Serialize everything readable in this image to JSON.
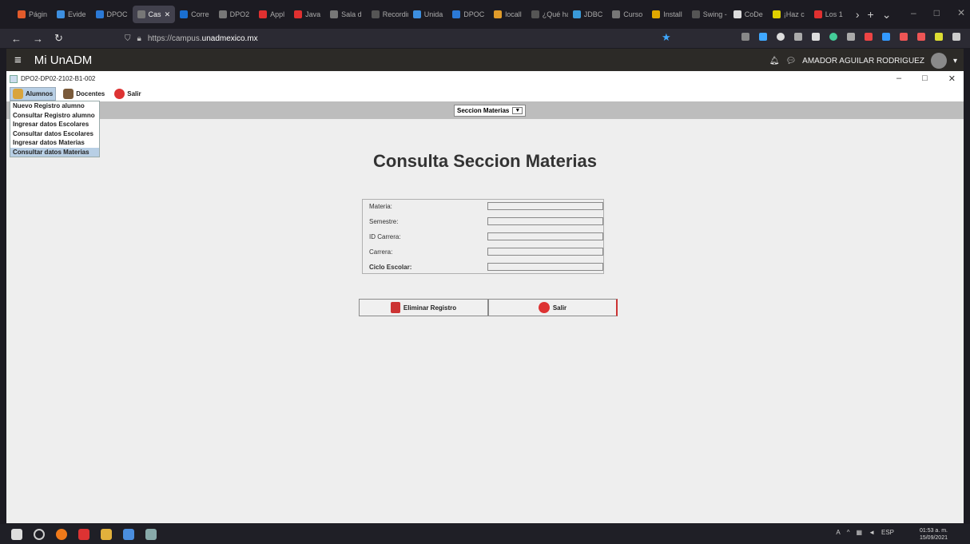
{
  "browser": {
    "tabs": [
      {
        "label": "Págin",
        "color": "#e25b2b",
        "active": false
      },
      {
        "label": "Evide",
        "color": "#3d8fe0",
        "active": false
      },
      {
        "label": "DPOC",
        "color": "#2b79d6",
        "active": false
      },
      {
        "label": "Cas",
        "color": "#777777",
        "active": true
      },
      {
        "label": "Corre",
        "color": "#1a6fd1",
        "active": false
      },
      {
        "label": "DPO2",
        "color": "#777777",
        "active": false
      },
      {
        "label": "Appl",
        "color": "#e03030",
        "active": false
      },
      {
        "label": "Java",
        "color": "#e03030",
        "active": false
      },
      {
        "label": "Sala d",
        "color": "#777777",
        "active": false
      },
      {
        "label": "Recording",
        "color": "#555555",
        "active": false
      },
      {
        "label": "Unida",
        "color": "#3d8fe0",
        "active": false
      },
      {
        "label": "DPOC",
        "color": "#2b79d6",
        "active": false
      },
      {
        "label": "locall",
        "color": "#e09b2a",
        "active": false
      },
      {
        "label": "¿Qué hay",
        "color": "#555555",
        "active": false
      },
      {
        "label": "JDBC",
        "color": "#3a9ad9",
        "active": false
      },
      {
        "label": "Curso",
        "color": "#777777",
        "active": false
      },
      {
        "label": "Install",
        "color": "#e0a800",
        "active": false
      },
      {
        "label": "Swing - J",
        "color": "#555555",
        "active": false
      },
      {
        "label": "CoDe",
        "color": "#dddddd",
        "active": false
      },
      {
        "label": "¡Haz c",
        "color": "#e0d000",
        "active": false
      },
      {
        "label": "Los 1",
        "color": "#e03030",
        "active": false
      }
    ],
    "url_prefix": "https://campus.",
    "url_domain": "unadmexico.mx"
  },
  "site": {
    "title": "Mi UnADM",
    "user": "AMADOR AGUILAR RODRIGUEZ"
  },
  "java_window": {
    "title": "DPO2-DP02-2102-B1-002",
    "menu": {
      "alumnos": "Alumnos",
      "docentes": "Docentes",
      "salir": "Salir"
    },
    "combo_value": "Seccion Materias",
    "dropdown": [
      "Nuevo Registro alumno",
      "Consultar Registro alumno",
      "Ingresar datos Escolares",
      "Consultar datos Escolares",
      "Ingresar datos Materias",
      "Consultar datos Materias"
    ],
    "heading": "Consulta Seccion Materias",
    "fields": {
      "materia": "Materia:",
      "semestre": "Semestre:",
      "id_carrera": "ID Carrera:",
      "carrera": "Carrera:",
      "ciclo": "Ciclo Escolar:"
    },
    "buttons": {
      "eliminar": "Eliminar Registro",
      "salir": "Salir"
    }
  },
  "taskbar": {
    "lang": "ESP",
    "time": "01:53 a. m.",
    "date": "15/09/2021"
  }
}
